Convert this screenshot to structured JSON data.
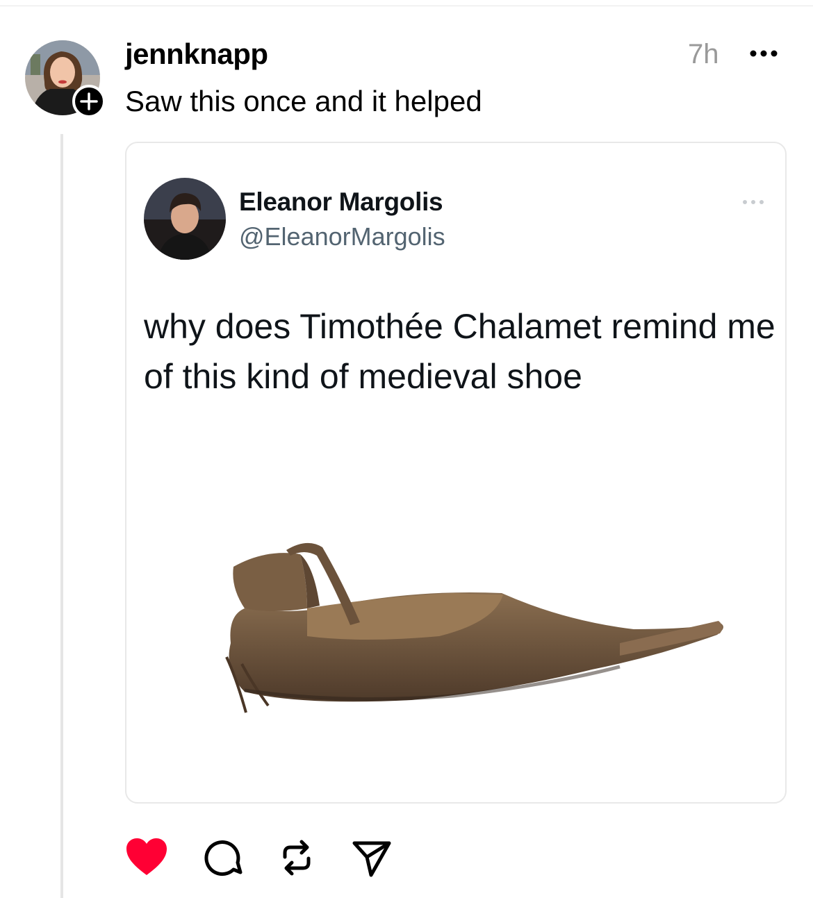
{
  "post": {
    "username": "jennknapp",
    "timestamp": "7h",
    "text": "Saw this once and it helped",
    "avatar_icon": "profile-photo",
    "follow_icon": "plus-icon",
    "more_icon": "ellipsis-icon"
  },
  "embed": {
    "display_name": "Eleanor Margolis",
    "handle": "@EleanorMargolis",
    "text": "why does Timothée Chalamet remind me of this kind of medieval shoe",
    "image": "medieval-pointed-leather-shoe"
  },
  "actions": {
    "like_icon": "heart-icon",
    "liked": true,
    "like_color": "#ff0034",
    "comment_icon": "comment-icon",
    "repost_icon": "repost-icon",
    "share_icon": "send-icon"
  }
}
